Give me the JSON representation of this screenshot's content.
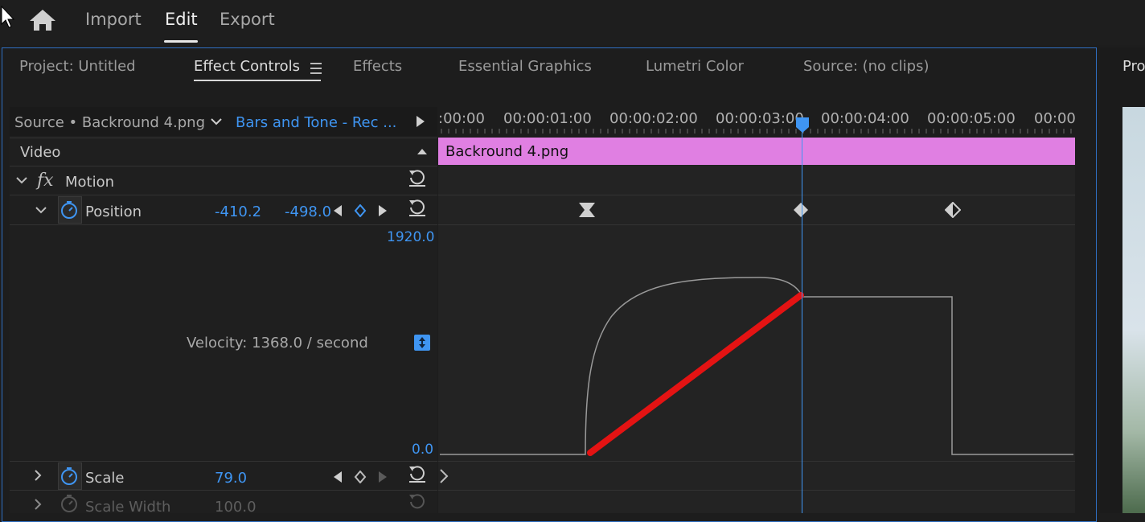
{
  "workspace": {
    "tabs": [
      {
        "label": "Import"
      },
      {
        "label": "Edit"
      },
      {
        "label": "Export"
      }
    ]
  },
  "panel": {
    "tabs": [
      {
        "label": "Project: Untitled"
      },
      {
        "label": "Effect Controls"
      },
      {
        "label": "Effects"
      },
      {
        "label": "Essential Graphics"
      },
      {
        "label": "Lumetri Color"
      },
      {
        "label": "Source: (no clips)"
      }
    ],
    "right_tab": "Pro"
  },
  "effect_controls": {
    "source_label": "Source • Backround 4.png",
    "sequence_label": "Bars and Tone - Rec ...",
    "video_label": "Video",
    "motion_label": "Motion",
    "fx_label": "fx",
    "position": {
      "label": "Position",
      "x": "-410.2",
      "y": "-498.0"
    },
    "graph_max": "1920.0",
    "graph_min": "0.0",
    "velocity": "Velocity: 1368.0 / second",
    "scale": {
      "label": "Scale",
      "value": "79.0"
    },
    "scale_width": {
      "label": "Scale Width",
      "value": "100.0"
    }
  },
  "timeline": {
    "ticks": [
      ":00:00",
      "00:00:01:00",
      "00:00:02:00",
      "00:00:03:00",
      "00:00:04:00",
      "00:00:05:00",
      "00:00"
    ],
    "clip_name": "Backround 4.png"
  },
  "colors": {
    "accent_blue": "#3f95f2",
    "clip_pink": "#e07fe2",
    "annotation_red": "#e41313"
  }
}
